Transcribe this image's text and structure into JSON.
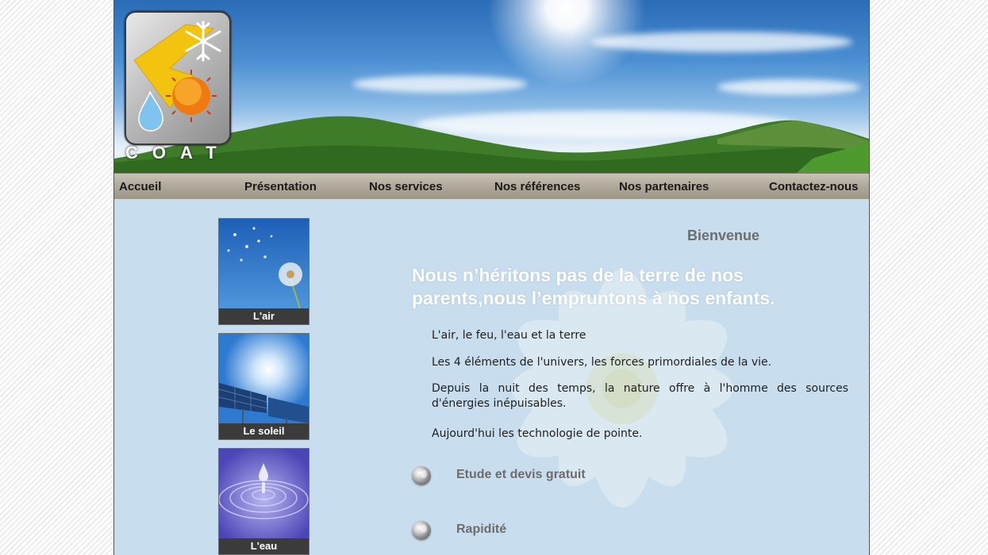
{
  "brand": {
    "logo_text": "COAT"
  },
  "nav": {
    "items": [
      "Accueil",
      "Présentation",
      "Nos services",
      "Nos références",
      "Nos partenaires",
      "Contactez-nous"
    ]
  },
  "sidebar": {
    "thumbnails": [
      {
        "caption": "L'air",
        "icon": "dandelion-image"
      },
      {
        "caption": "Le soleil",
        "icon": "solar-panel-image"
      },
      {
        "caption": "L'eau",
        "icon": "water-drop-image"
      }
    ]
  },
  "main": {
    "section_title": "Bienvenue",
    "headline": "Nous n’héritons pas de la terre de nos parents,nous l’empruntons à nos enfants.",
    "paragraphs": [
      "L'air, le feu, l'eau et la terre",
      "Les 4 éléments de l'univers, les forces primordiales de la vie.",
      "Depuis la nuit des temps, la nature offre à l'homme des sources d'énergies inépuisables.",
      "Aujourd'hui les technologie de pointe."
    ],
    "bullets": [
      "Etude et devis gratuit",
      "Rapidité"
    ]
  },
  "colors": {
    "content_bg": "#c8ddee",
    "nav_bg": "#b2aa9c",
    "welcome_text": "#6d6d6d",
    "headline_text": "#ffffff"
  }
}
